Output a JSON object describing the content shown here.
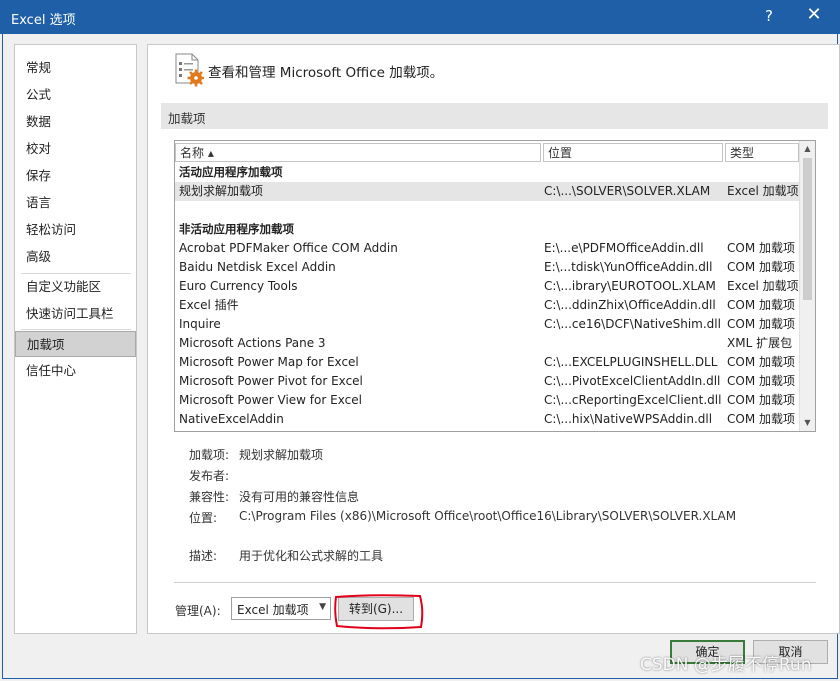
{
  "window": {
    "title": "Excel 选项",
    "help": "?",
    "close": "✕"
  },
  "sidebar": {
    "items": [
      {
        "label": "常规"
      },
      {
        "label": "公式"
      },
      {
        "label": "数据"
      },
      {
        "label": "校对"
      },
      {
        "label": "保存"
      },
      {
        "label": "语言"
      },
      {
        "label": "轻松访问"
      },
      {
        "label": "高级"
      },
      {
        "label": "自定义功能区"
      },
      {
        "label": "快速访问工具栏"
      },
      {
        "label": "加载项",
        "selected": true
      },
      {
        "label": "信任中心"
      }
    ]
  },
  "main": {
    "header_title": "查看和管理 Microsoft Office 加载项。",
    "section_title": "加载项",
    "columns": {
      "name": "名称 ▴",
      "location": "位置",
      "type": "类型"
    },
    "groups": {
      "active": "活动应用程序加载项",
      "inactive": "非活动应用程序加载项"
    },
    "active_rows": [
      {
        "name": "规划求解加载项",
        "location": "C:\\...\\SOLVER\\SOLVER.XLAM",
        "type": "Excel 加载项"
      }
    ],
    "inactive_rows": [
      {
        "name": "Acrobat PDFMaker Office COM Addin",
        "location": "E:\\...e\\PDFMOfficeAddin.dll",
        "type": "COM 加载项"
      },
      {
        "name": "Baidu Netdisk Excel Addin",
        "location": "E:\\...tdisk\\YunOfficeAddin.dll",
        "type": "COM 加载项"
      },
      {
        "name": "Euro Currency Tools",
        "location": "C:\\...ibrary\\EUROTOOL.XLAM",
        "type": "Excel 加载项"
      },
      {
        "name": "Excel 插件",
        "location": "C:\\...ddinZhix\\OfficeAddin.dll",
        "type": "COM 加载项"
      },
      {
        "name": "Inquire",
        "location": "C:\\...ce16\\DCF\\NativeShim.dll",
        "type": "COM 加载项"
      },
      {
        "name": "Microsoft Actions Pane 3",
        "location": "",
        "type": "XML 扩展包"
      },
      {
        "name": "Microsoft Power Map for Excel",
        "location": "C:\\...EXCELPLUGINSHELL.DLL",
        "type": "COM 加载项"
      },
      {
        "name": "Microsoft Power Pivot for Excel",
        "location": "C:\\...PivotExcelClientAddIn.dll",
        "type": "COM 加载项"
      },
      {
        "name": "Microsoft Power View for Excel",
        "location": "C:\\...cReportingExcelClient.dll",
        "type": "COM 加载项"
      },
      {
        "name": "NativeExcelAddin",
        "location": "C:\\...hix\\NativeWPSAddin.dll",
        "type": "COM 加载项"
      }
    ],
    "details": {
      "addin_label": "加载项:",
      "addin_value": "规划求解加载项",
      "publisher_label": "发布者:",
      "publisher_value": "",
      "compat_label": "兼容性:",
      "compat_value": "没有可用的兼容性信息",
      "location_label": "位置:",
      "location_value": "C:\\Program Files (x86)\\Microsoft Office\\root\\Office16\\Library\\SOLVER\\SOLVER.XLAM",
      "desc_label": "描述:",
      "desc_value": "用于优化和公式求解的工具"
    },
    "manage_label": "管理(A):",
    "manage_value": "Excel 加载项",
    "goto_label": "转到(G)..."
  },
  "footer": {
    "ok_label": "确定",
    "cancel_label": "取消"
  },
  "watermark": "CSDN @步履不停Run",
  "colors": {
    "titlebar": "#1e5fa8",
    "annotation": "#e0001b"
  }
}
